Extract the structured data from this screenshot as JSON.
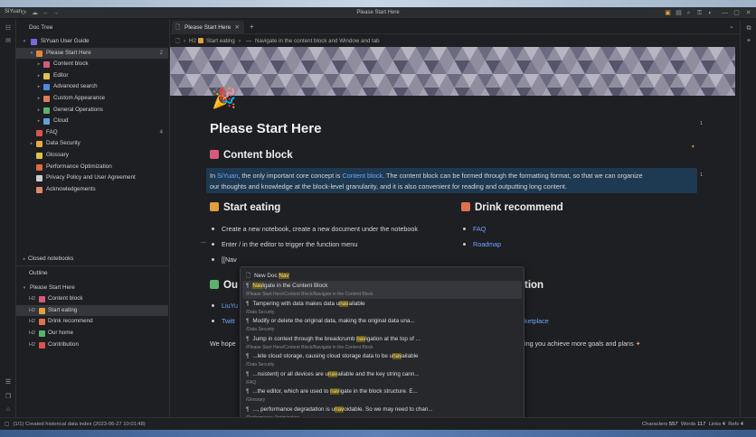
{
  "app": {
    "brand": "SiYuan",
    "window_title": "Please Start Here"
  },
  "sidebar": {
    "doc_tree_title": "Doc Tree",
    "notebook": "SiYuan User Guide",
    "tree": [
      {
        "label": "Please Start Here",
        "count": "2",
        "level": 1,
        "selected": true,
        "color": "#e0883a"
      },
      {
        "label": "Content block",
        "level": 2,
        "color": "#d65a7a"
      },
      {
        "label": "Editor",
        "level": 2,
        "color": "#e5c24a"
      },
      {
        "label": "Advanced search",
        "level": 2,
        "color": "#4c8be0"
      },
      {
        "label": "Custom Appearance",
        "level": 2,
        "color": "#e27b5a"
      },
      {
        "label": "General Operations",
        "level": 2,
        "color": "#5bb36b"
      },
      {
        "label": "Cloud",
        "level": 2,
        "color": "#5ea4d8"
      },
      {
        "label": "FAQ",
        "count": "4",
        "level": 1,
        "color": "#d9534f"
      },
      {
        "label": "Data Security",
        "level": 1,
        "color": "#e6a93d"
      },
      {
        "label": "Glossary",
        "level": 1,
        "color": "#e0c14a"
      },
      {
        "label": "Performance Optimization",
        "level": 1,
        "color": "#e06a3a"
      },
      {
        "label": "Privacy Policy and User Agreement",
        "level": 1,
        "color": "#cccccc"
      },
      {
        "label": "Acknowledgements",
        "level": 1,
        "color": "#d98a6a"
      }
    ],
    "closed_notebooks": "Closed notebooks",
    "outline_title": "Outline",
    "outline": [
      {
        "tag": "",
        "label": "Please Start Here"
      },
      {
        "tag": "H2",
        "label": "Content block",
        "color": "#d65a7a"
      },
      {
        "tag": "H2",
        "label": "Start eating",
        "color": "#e0a040",
        "selected": true
      },
      {
        "tag": "H2",
        "label": "Drink recommend",
        "color": "#e07050"
      },
      {
        "tag": "H2",
        "label": "Our home",
        "color": "#5bb36b"
      },
      {
        "tag": "H2",
        "label": "Contribution",
        "color": "#d9534f"
      }
    ]
  },
  "tab": {
    "label": "Please Start Here"
  },
  "breadcrumb": {
    "h2": "H2",
    "section": "Start eating",
    "block": "Navigate in the content block and Window and tab"
  },
  "doc": {
    "title": "Please Start Here",
    "content_block_heading": "Content block",
    "content_block_text_pre": "In ",
    "siyuan_link": "SiYuan",
    "content_block_text_mid": ", the only important core concept is ",
    "content_block_link": "Content block",
    "content_block_text_post": ". The content block can be formed through the formatting format, so that we can organize",
    "content_block_line2": "our thoughts and knowledge at the block-level granularity, and it is also convenient for reading and outputting long content.",
    "start_eating_heading": "Start eating",
    "bullets": [
      "Create a new notebook, create a new document under the notebook",
      "Enter / in the editor to trigger the function menu",
      "[[Nav"
    ],
    "drink_heading": "Drink recommend",
    "drink_links": [
      "FAQ",
      "Roadmap"
    ],
    "our_home_partial": "Ou",
    "our_home_links": [
      "LiuYu",
      "Twitt"
    ],
    "right_partial": "tion",
    "marketplace_partial": "ketplace",
    "we_hope": "We hope",
    "we_hope_right": "ing you achieve more goals and plans",
    "counts": {
      "title": "1",
      "content": "1"
    }
  },
  "popup": {
    "items": [
      {
        "title": "New Doc Nav",
        "path": "",
        "icon": "doc"
      },
      {
        "title": "Navigate in the Content Block",
        "path": "/Please Start Here/Content Block/Navigate in the Content Block",
        "icon": "para",
        "selected": true
      },
      {
        "title": "Tampering with data makes data unavailable",
        "path": "/Data Security",
        "icon": "para"
      },
      {
        "title": "Modify or delete the original data, making the original data una...",
        "path": "/Data Security",
        "icon": "para"
      },
      {
        "title": "Jump in context through the breadcrumb navigation at the top of ...",
        "path": "/Please Start Here/Content Block/Navigate in the Content Block",
        "icon": "para"
      },
      {
        "title": "...lete cloud storage, causing cloud storage data to be unavailable",
        "path": "/Data Security",
        "icon": "para"
      },
      {
        "title": "...nsistent) or all devices are unavailable and the key string cann...",
        "path": "/FAQ",
        "icon": "para"
      },
      {
        "title": "...the editor, which are used to navigate in the block structure. E...",
        "path": "/Glossary",
        "icon": "para"
      },
      {
        "title": "..., performance degradation is unavoidable. So we may need to chan...",
        "path": "/Performance Optimization",
        "icon": "para"
      }
    ]
  },
  "status": {
    "left": "(1/1) Created historical data index (2023-06-27 10:01:48)",
    "characters_label": "Characters",
    "characters": "557",
    "words_label": "Words",
    "words": "117",
    "links_label": "Links",
    "links": "4",
    "refs_label": "Refs",
    "refs": "4"
  }
}
